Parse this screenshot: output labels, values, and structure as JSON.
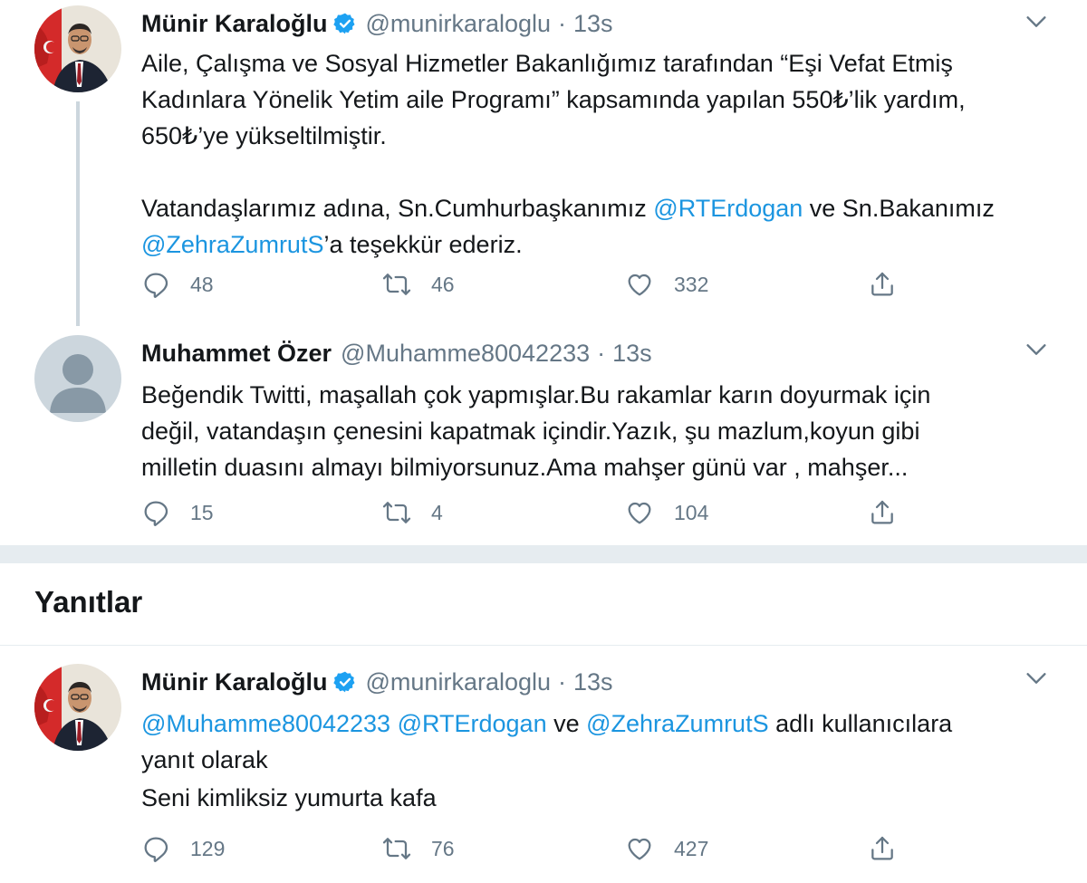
{
  "tweet1": {
    "name": "Münir Karaloğlu",
    "handle": "@munirkaraloglu",
    "dot": "·",
    "time": "13s",
    "text_parts": [
      {
        "t": "Aile, Çalışma ve Sosyal Hizmetler Bakanlığımız tarafından “Eşi Vefat Etmiş\nKadınlara Yönelik Yetim aile Programı” kapsamında yapılan 550₺’lik yardım,\n650₺’ye yükseltilmiştir.\n\nVatandaşlarımız adına, Sn.Cumhurbaşkanımız "
      },
      {
        "t": "@RTErdogan",
        "mention": true
      },
      {
        "t": " ve Sn.Bakanımız\n"
      },
      {
        "t": "@ZehraZumrutS",
        "mention": true
      },
      {
        "t": "’a teşekkür ederiz."
      }
    ],
    "replies": "48",
    "retweets": "46",
    "likes": "332"
  },
  "tweet2": {
    "name": "Muhammet Özer",
    "handle": "@Muhamme80042233",
    "dot": "·",
    "time": "13s",
    "text_parts": [
      {
        "t": "Beğendik Twitti, maşallah çok yapmışlar.Bu rakamlar karın doyurmak için\ndeğil, vatandaşın çenesini kapatmak içindir.Yazık, şu mazlum,koyun gibi\nmilletin duasını almayı bilmiyorsunuz.Ama mahşer günü var , mahşer..."
      }
    ],
    "replies": "15",
    "retweets": "4",
    "likes": "104"
  },
  "section": {
    "title": "Yanıtlar"
  },
  "tweet3": {
    "name": "Münir Karaloğlu",
    "handle": "@munirkaraloglu",
    "dot": "·",
    "time": "13s",
    "reply_parts": [
      {
        "t": "@Muhamme80042233",
        "mention": true
      },
      {
        "t": " "
      },
      {
        "t": "@RTErdogan",
        "mention": true
      },
      {
        "t": " ve "
      },
      {
        "t": "@ZehraZumrutS",
        "mention": true
      },
      {
        "t": " adlı kullanıcılara\nyanıt olarak"
      }
    ],
    "text": "Seni kimliksiz yumurta kafa",
    "replies": "129",
    "retweets": "76",
    "likes": "427"
  },
  "colors": {
    "text": "#14171a",
    "secondary": "#657786",
    "mention": "#1b95e0",
    "verified": "#1da1f2",
    "separator": "#e6ecf0"
  },
  "icons": {
    "reply": "reply-icon",
    "retweet": "retweet-icon",
    "like": "heart-icon",
    "share": "share-icon",
    "verified": "verified-badge-icon",
    "caret": "chevron-down-icon"
  }
}
